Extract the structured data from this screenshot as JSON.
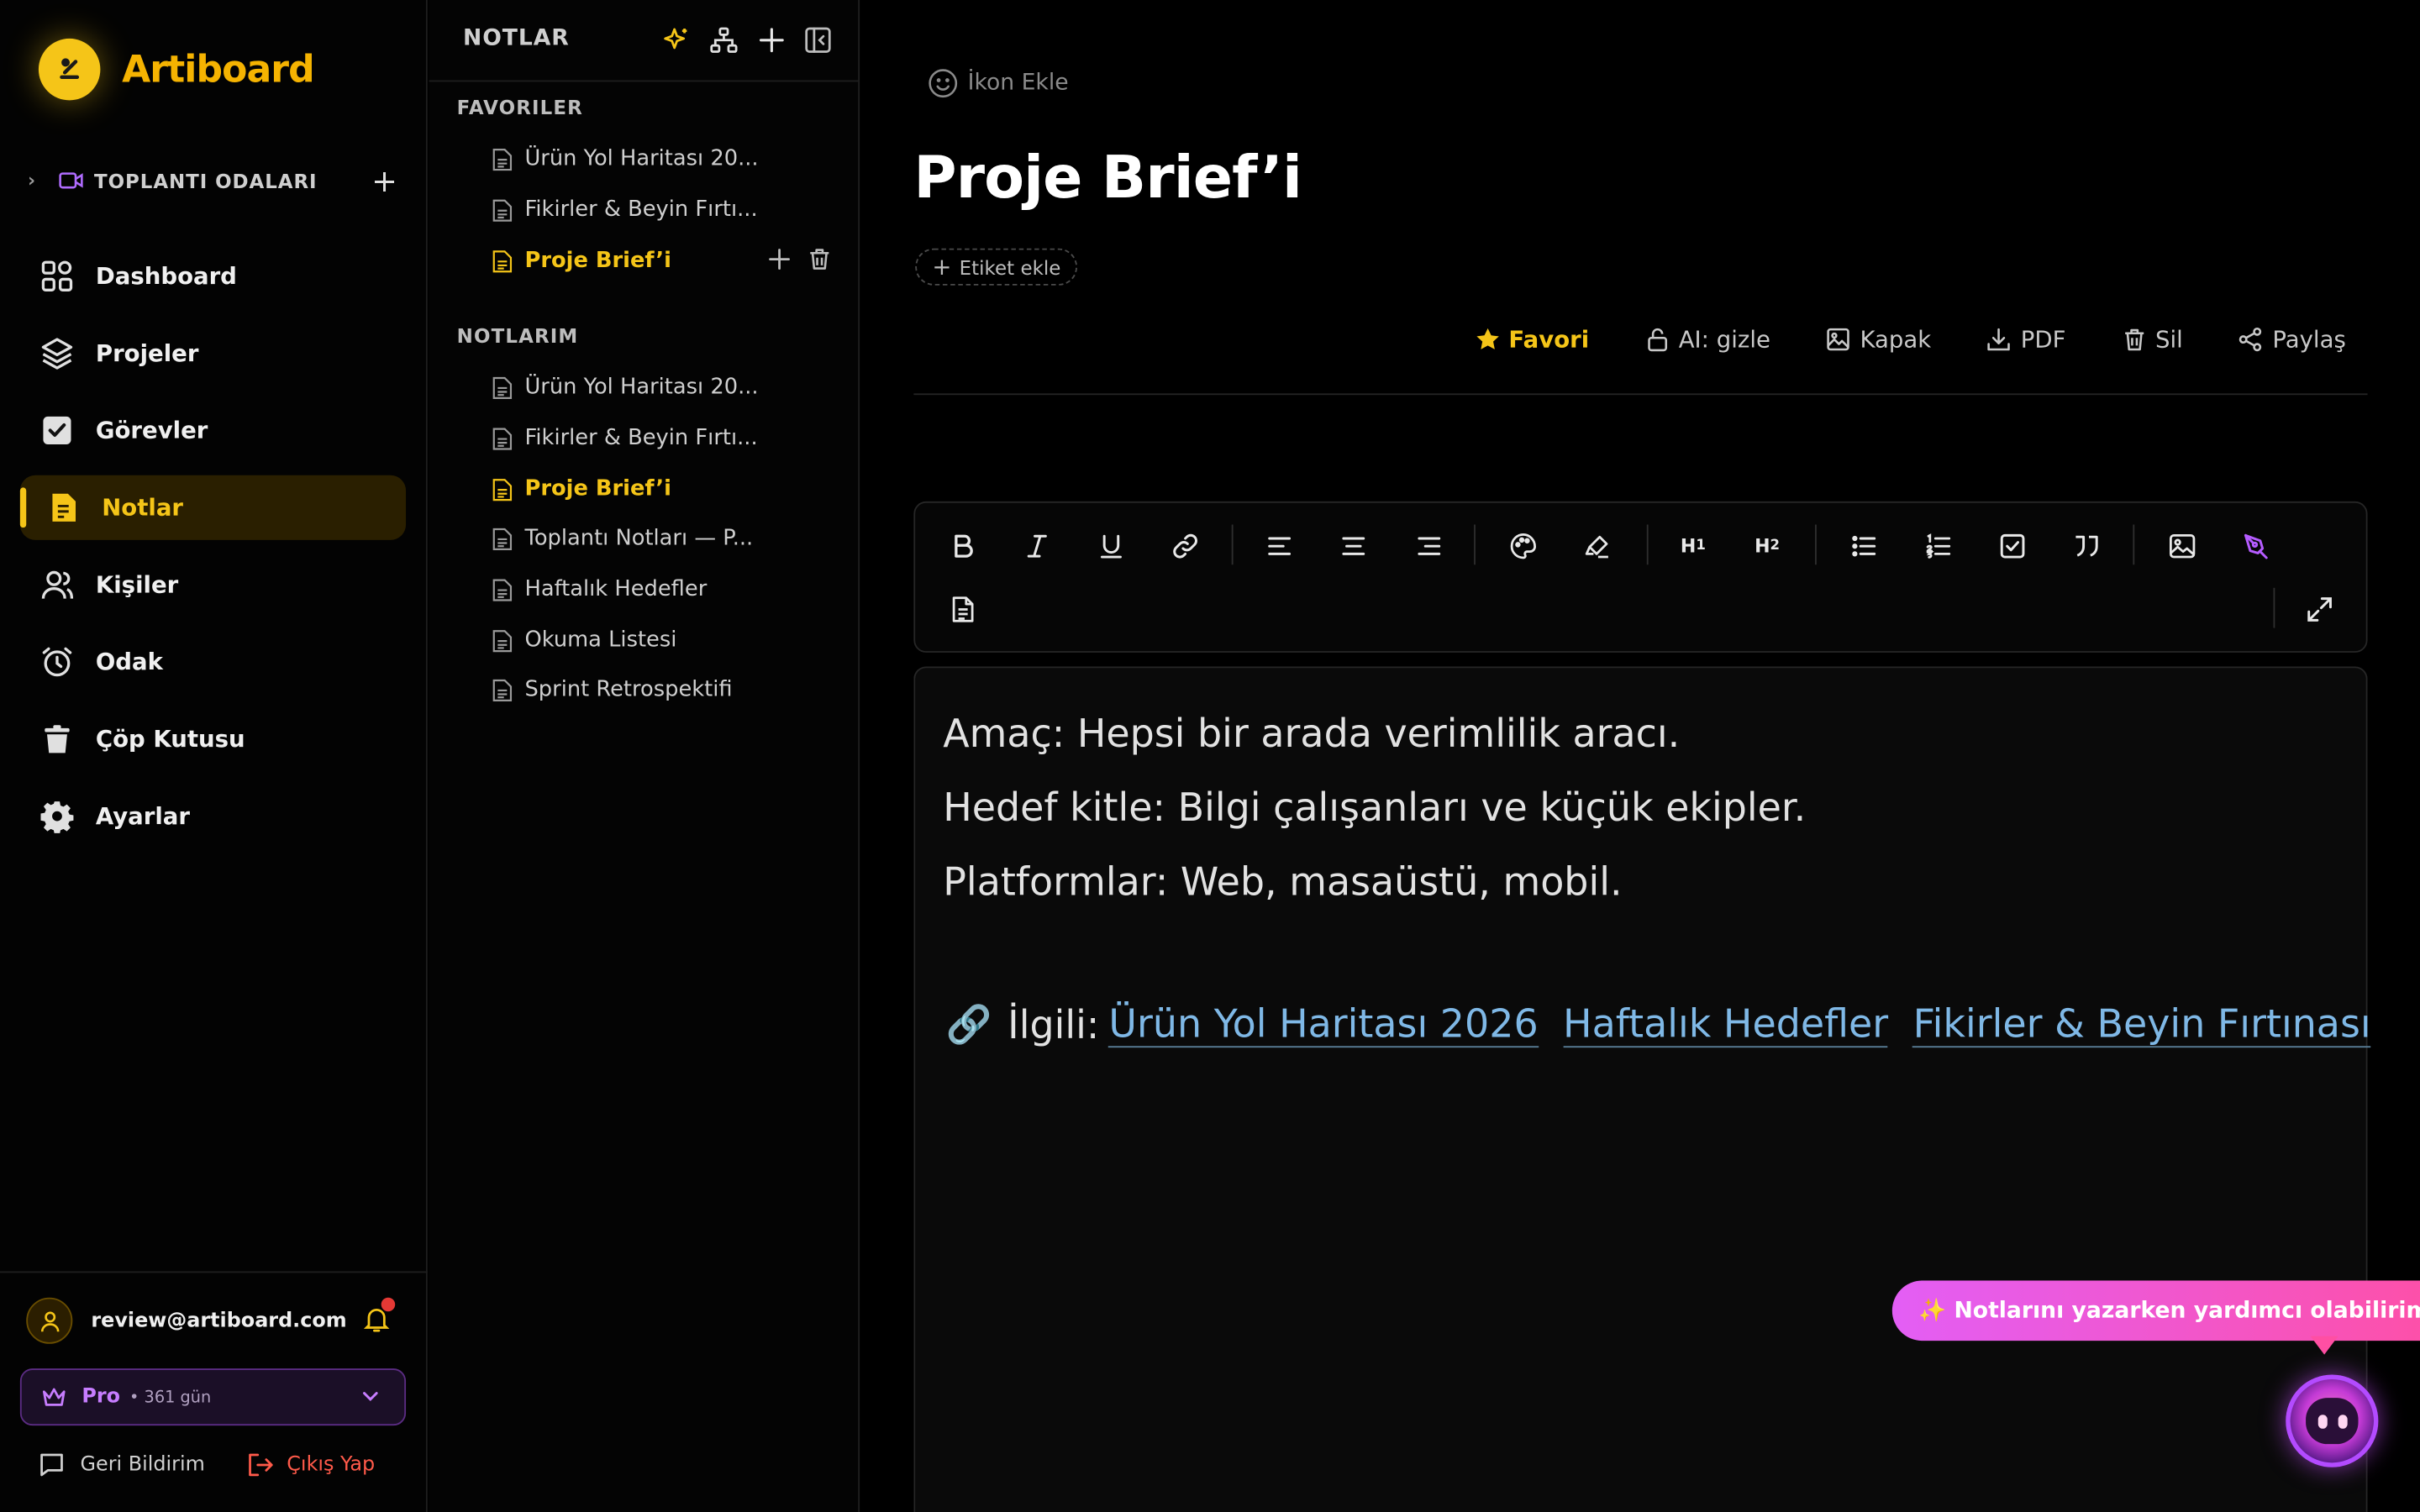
{
  "brand": {
    "name": "Artiboard"
  },
  "meeting_rooms": {
    "label": "TOPLANTI ODALARI"
  },
  "nav": [
    {
      "label": "Dashboard",
      "icon": "dashboard-icon"
    },
    {
      "label": "Projeler",
      "icon": "layers-icon"
    },
    {
      "label": "Görevler",
      "icon": "checkbox-icon"
    },
    {
      "label": "Notlar",
      "icon": "note-icon",
      "active": true
    },
    {
      "label": "Kişiler",
      "icon": "users-icon"
    },
    {
      "label": "Odak",
      "icon": "alarm-clock-icon"
    },
    {
      "label": "Çöp Kutusu",
      "icon": "trash-icon"
    },
    {
      "label": "Ayarlar",
      "icon": "gear-icon"
    }
  ],
  "user": {
    "email": "review@artiboard.com"
  },
  "plan": {
    "name": "Pro",
    "days": "• 361 gün"
  },
  "footer": {
    "feedback": "Geri Bildirim",
    "logout": "Çıkış Yap"
  },
  "notes_panel": {
    "title": "NOTLAR",
    "favorites_title": "FAVORILER",
    "favorites": [
      {
        "label": "Ürün Yol Haritası 20..."
      },
      {
        "label": "Fikirler & Beyin Fırtı..."
      },
      {
        "label": "Proje Brief’i",
        "active": true
      }
    ],
    "mynotes_title": "NOTLARIM",
    "mynotes": [
      {
        "label": "Ürün Yol Haritası 20..."
      },
      {
        "label": "Fikirler & Beyin Fırtı..."
      },
      {
        "label": "Proje Brief’i",
        "active": true
      },
      {
        "label": "Toplantı Notları — P..."
      },
      {
        "label": "Haftalık Hedefler"
      },
      {
        "label": "Okuma Listesi"
      },
      {
        "label": "Sprint Retrospektifi"
      }
    ]
  },
  "main": {
    "add_icon": "İkon Ekle",
    "title": "Proje Brief’i",
    "add_tag": "Etiket ekle",
    "actions": {
      "favorite": "Favori",
      "ai_hide": "AI: gizle",
      "cover": "Kapak",
      "pdf": "PDF",
      "delete": "Sil",
      "share": "Paylaş"
    },
    "content": {
      "line1": "Amaç: Hepsi bir arada verimlilik aracı.",
      "line2": "Hedef kitle: Bilgi çalışanları ve küçük ekipler.",
      "line3": "Platformlar: Web, masaüstü, mobil.",
      "related_label": "İlgili:",
      "related_emoji": "🔗",
      "links": [
        "Ürün Yol Haritası 2026",
        "Haftalık Hedefler",
        "Fikirler & Beyin Fırtınası"
      ]
    }
  },
  "toolbar": {
    "h1": "H",
    "h1_sub": "1",
    "h2": "H",
    "h2_sub": "2"
  },
  "assistant": {
    "message": "✨ Notlarını yazarken yardımcı olabilirim!"
  },
  "colors": {
    "accent": "#f5c518",
    "link": "#7fb8e6",
    "logout": "#ff5a4a",
    "plan": "#c77dff"
  }
}
